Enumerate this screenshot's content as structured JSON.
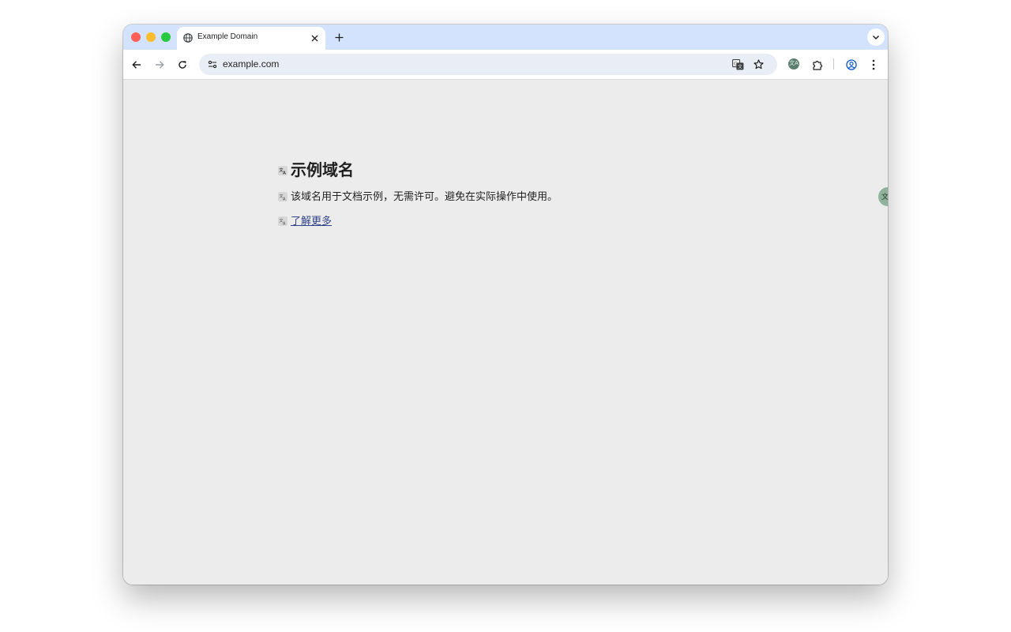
{
  "browser": {
    "tab": {
      "title": "Example Domain",
      "favicon": "globe-icon"
    },
    "address_bar": {
      "url": "example.com"
    },
    "icons": {
      "back": "arrow-left-icon",
      "forward": "arrow-right-icon",
      "reload": "reload-icon",
      "site_info": "tune-icon",
      "translate": "translate-icon",
      "bookmark": "star-icon",
      "extensions": "puzzle-icon",
      "profile": "account-icon",
      "menu": "kebab-menu-icon",
      "new_tab": "plus-icon",
      "tab_search": "chevron-down-icon"
    },
    "extension_avatar_text": "文A"
  },
  "page": {
    "heading": "示例域名",
    "paragraph": "该域名用于文档示例，无需许可。避免在实际操作中使用。",
    "link_text": "了解更多"
  },
  "colors": {
    "tabstrip": "#d3e3fd",
    "omnibox": "#e9eef6",
    "page_background": "#ececec",
    "link": "#334488",
    "close_light": "#ff5f57",
    "minimize_light": "#febc2e",
    "maximize_light": "#28c840"
  }
}
